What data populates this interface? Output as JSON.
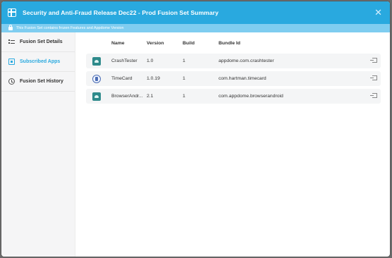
{
  "header": {
    "title": "Security and Anti-Fraud Release Dec22 - Prod Fusion Set Summary",
    "icon": "grid-icon",
    "close_label": "✕",
    "accent": "#29a9df"
  },
  "banner": {
    "text": "This Fusion Set contains frozen Features and Appdome Version",
    "icon": "lock-icon"
  },
  "sidebar": {
    "items": [
      {
        "label": "Fusion Set Details",
        "icon": "list-icon",
        "active": false
      },
      {
        "label": "Subscribed Apps",
        "icon": "apps-icon",
        "active": true
      },
      {
        "label": "Fusion Set History",
        "icon": "history-icon",
        "active": false
      }
    ]
  },
  "table": {
    "columns": [
      "Name",
      "Version",
      "Build",
      "Bundle Id"
    ],
    "rows": [
      {
        "name": "CrashTester",
        "version": "1.0",
        "build": "1",
        "bundle_id": "appdome.com.crashtester",
        "icon": "android-icon"
      },
      {
        "name": "TimeCard",
        "version": "1.0.19",
        "build": "1",
        "bundle_id": "com.hartman.timecard",
        "icon": "timecard-icon"
      },
      {
        "name": "BrowserAndr...",
        "version": "2.1",
        "build": "1",
        "bundle_id": "com.appdome.browserandroid",
        "icon": "android-icon"
      }
    ]
  }
}
